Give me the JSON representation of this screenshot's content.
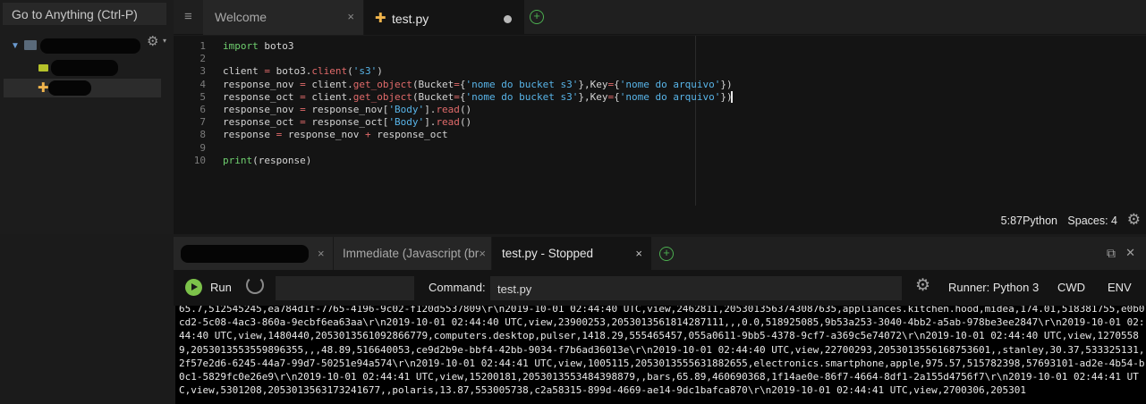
{
  "sidebar": {
    "goto_placeholder": "Go to Anything (Ctrl-P)",
    "icons": {
      "root_arrow": "chevron-down-icon",
      "folder": "folder-icon",
      "markdown": "markdown-file-icon",
      "python": "python-file-icon",
      "settings": "gear-icon"
    }
  },
  "editor_tabs": [
    {
      "label": "Welcome",
      "close": "×"
    },
    {
      "label": "test.py",
      "modified": true
    }
  ],
  "editor": {
    "line_numbers": [
      "1",
      "2",
      "3",
      "4",
      "5",
      "6",
      "7",
      "8",
      "9",
      "10"
    ],
    "lines": [
      "import boto3",
      "",
      "client = boto3.client('s3')",
      "response_nov = client.get_object(Bucket={'nome do bucket s3'},Key={'nome do arquivo'})",
      "response_oct = client.get_object(Bucket={'nome do bucket s3'},Key={'nome do arquivo'})",
      "response_nov = response_nov['Body'].read()",
      "response_oct = response_oct['Body'].read()",
      "response = response_nov + response_oct",
      "",
      "print(response)"
    ]
  },
  "statusbar": {
    "position": "5:87",
    "language": "Python",
    "spaces": "Spaces: 4"
  },
  "panel_tabs": [
    {
      "label": "",
      "close": "×"
    },
    {
      "label": "Immediate (Javascript (br",
      "close": "×"
    },
    {
      "label": "test.py - Stopped",
      "close": "×"
    }
  ],
  "run_toolbar": {
    "run_label": "Run",
    "command_label": "Command:",
    "command_value": "test.py",
    "runner_label": "Runner: Python 3",
    "cwd_label": "CWD",
    "env_label": "ENV"
  },
  "output_text": "65.7,512545245,ea784d1f-7765-4196-9c02-f120d5537809\\r\\n2019-10-01 02:44:40 UTC,view,2462811,2053013563743087635,appliances.kitchen.hood,midea,174.01,518381755,e0b0cd2-5c08-4ac3-860a-9ecbf6ea63aa\\r\\n2019-10-01 02:44:40 UTC,view,23900253,2053013561814287111,,,0.0,518925085,9b53a253-3040-4bb2-a5ab-978be3ee2847\\r\\n2019-10-01 02:44:40 UTC,view,1480440,2053013561092866779,computers.desktop,pulser,1418.29,555465457,055a0611-9bb5-4378-9cf7-a369c5e74072\\r\\n2019-10-01 02:44:40 UTC,view,12705589,2053013553559896355,,,48.89,516640053,ce9d2b9e-bbf4-42bb-9034-f7b6ad36013e\\r\\n2019-10-01 02:44:40 UTC,view,22700293,2053013556168753601,,stanley,30.37,533325131,2f57e2d6-6245-44a7-99d7-50251e94a574\\r\\n2019-10-01 02:44:41 UTC,view,1005115,2053013555631882655,electronics.smartphone,apple,975.57,515782398,57693101-ad2e-4b54-b0c1-5829fc0e26e9\\r\\n2019-10-01 02:44:41 UTC,view,15200181,2053013553484398879,,bars,65.89,460690368,1f14ae0e-86f7-4664-8df1-2a155d4756f7\\r\\n2019-10-01 02:44:41 UTC,view,5301208,2053013563173241677,,polaris,13.87,553005738,c2a58315-899d-4669-ae14-9dc1bafca870\\r\\n2019-10-01 02:44:41 UTC,view,2700306,205301"
}
